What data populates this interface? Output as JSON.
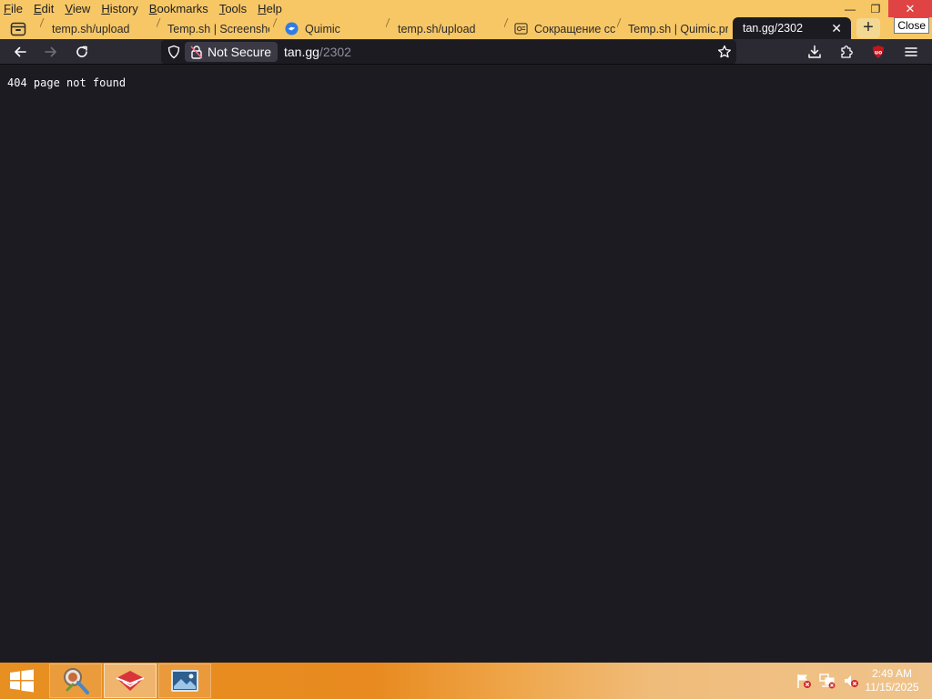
{
  "menu": [
    "File",
    "Edit",
    "View",
    "History",
    "Bookmarks",
    "Tools",
    "Help"
  ],
  "window": {
    "close_tooltip": "Close",
    "minimize_glyph": "—",
    "restore_glyph": "❐",
    "close_glyph": "✕"
  },
  "tabs": [
    {
      "title": "temp.sh/upload",
      "icon": "none"
    },
    {
      "title": "Temp.sh | Screensho",
      "icon": "none"
    },
    {
      "title": "Quimic",
      "icon": "quimic-icon"
    },
    {
      "title": "temp.sh/upload",
      "icon": "none"
    },
    {
      "title": "Сокращение сс",
      "icon": "shortener-icon"
    },
    {
      "title": "Temp.sh | Quimic.pr",
      "icon": "none"
    },
    {
      "title": "tan.gg/2302",
      "icon": "none",
      "active": true
    }
  ],
  "newtab_glyph": "+",
  "active_tab_close_glyph": "✕",
  "urlbar": {
    "security_label": "Not Secure",
    "host": "tan.gg",
    "path": "/2302"
  },
  "page": {
    "text": "404 page not found"
  },
  "clock": {
    "time": "2:49 AM",
    "date": "11/15/2025"
  },
  "colors": {
    "titlebar": "#f7c766",
    "content_bg": "#1c1b22",
    "navbar": "#2b2a33",
    "close_red": "#e04343",
    "taskbar_orange": "#e79021"
  }
}
